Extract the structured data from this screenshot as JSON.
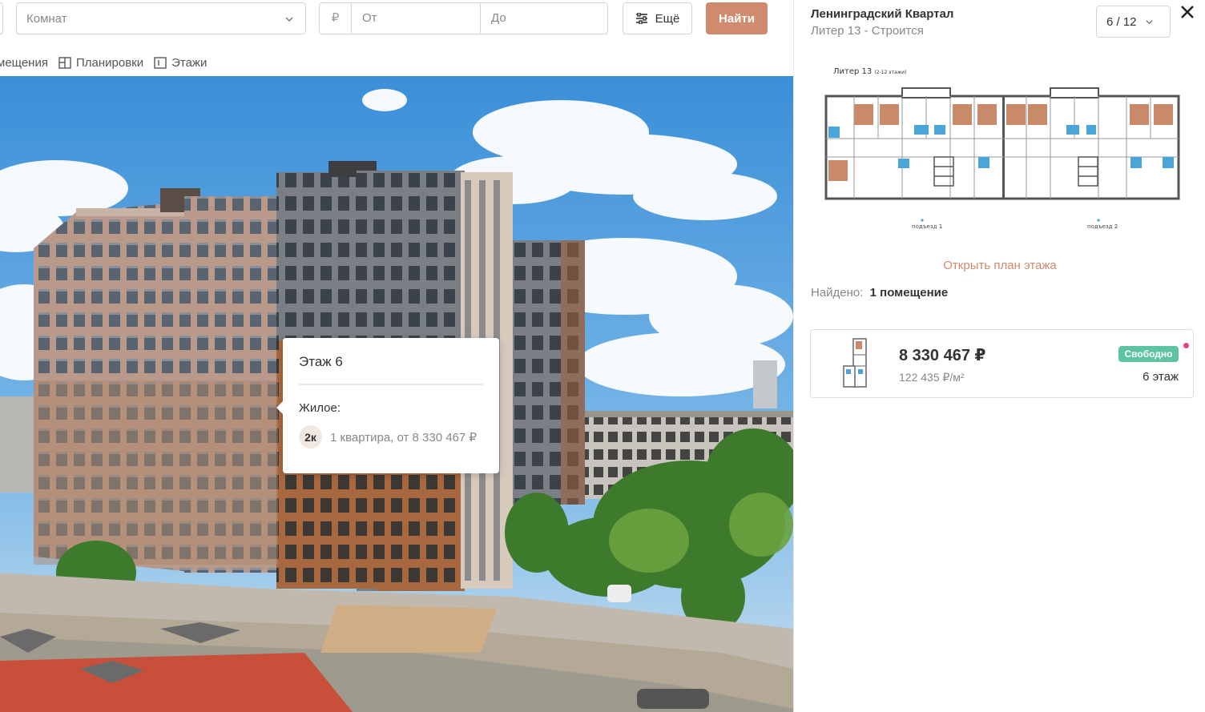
{
  "filters": {
    "rooms_placeholder": "Комнат",
    "currency_symbol": "₽",
    "price_from_placeholder": "От",
    "price_to_placeholder": "До",
    "more_label": "Ещё",
    "find_label": "Найти"
  },
  "views": {
    "premises": "мещения",
    "layouts": "Планировки",
    "floors": "Этажи"
  },
  "tooltip": {
    "title": "Этаж 6",
    "type": "Жилое:",
    "badge": "2к",
    "description": "1 квартира, от 8 330 467 ₽"
  },
  "panel": {
    "title": "Ленинградский Квартал",
    "subtitle": "Литер 13 - Строится",
    "floor_select": "6 / 12",
    "open_plan": "Открыть план этажа",
    "found_label": "Найдено:",
    "found_value": "1 помещение",
    "plan": {
      "title": "Литер 13",
      "title_note": "(2-12 этажи)",
      "entrance1": "подъезд 1",
      "entrance2": "подъезд 2"
    }
  },
  "card": {
    "price": "8 330 467 ₽",
    "price_per_sqm": "122 435 ₽/м²",
    "status": "Свободно",
    "floor": "6 этаж"
  },
  "colors": {
    "accent": "#d08a6e",
    "status_free": "#5ec4a0",
    "new_dot": "#e8467c"
  }
}
